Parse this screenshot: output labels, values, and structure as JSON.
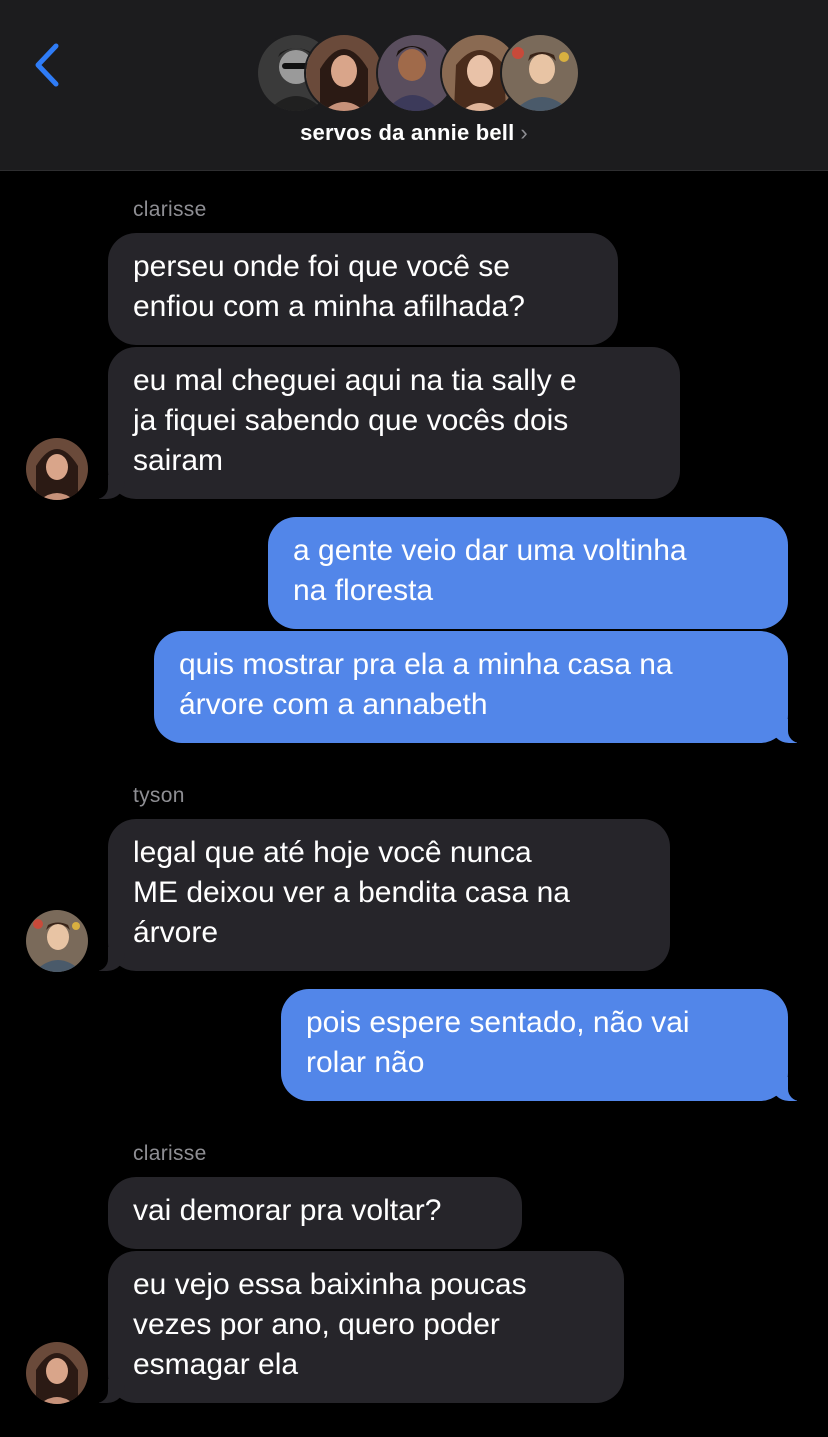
{
  "header": {
    "group_name": "servos da annie bell",
    "group_chevron": "›",
    "back_icon": "chevron-left-icon",
    "accent_color": "#2f7cf6"
  },
  "messages": [
    {
      "sender": "clarisse",
      "direction": "incoming",
      "text": "perseu onde foi que você se\nenfiou com a minha afilhada?"
    },
    {
      "sender": "clarisse",
      "direction": "incoming",
      "text": "eu mal cheguei aqui na tia sally e\nja fiquei sabendo que vocês dois\nsairam"
    },
    {
      "sender": "me",
      "direction": "outgoing",
      "text": "a gente veio dar uma voltinha\nna floresta"
    },
    {
      "sender": "me",
      "direction": "outgoing",
      "text": "quis mostrar pra ela a minha casa na\nárvore com a annabeth"
    },
    {
      "sender": "tyson",
      "direction": "incoming",
      "text": "legal que até hoje você nunca\nME deixou ver a bendita casa na\nárvore"
    },
    {
      "sender": "me",
      "direction": "outgoing",
      "text": "pois espere sentado, não vai\nrolar não"
    },
    {
      "sender": "clarisse",
      "direction": "incoming",
      "text": "vai demorar pra voltar?"
    },
    {
      "sender": "clarisse",
      "direction": "incoming",
      "text": "eu vejo essa baixinha poucas\nvezes por ano, quero poder\nesmagar ela"
    }
  ],
  "sender_labels": [
    "clarisse",
    "tyson",
    "clarisse"
  ],
  "colors": {
    "incoming_bubble": "#26252a",
    "outgoing_bubble": "#5286e9",
    "header_bg": "#1c1c1e",
    "sender_label": "#8e8e93"
  }
}
